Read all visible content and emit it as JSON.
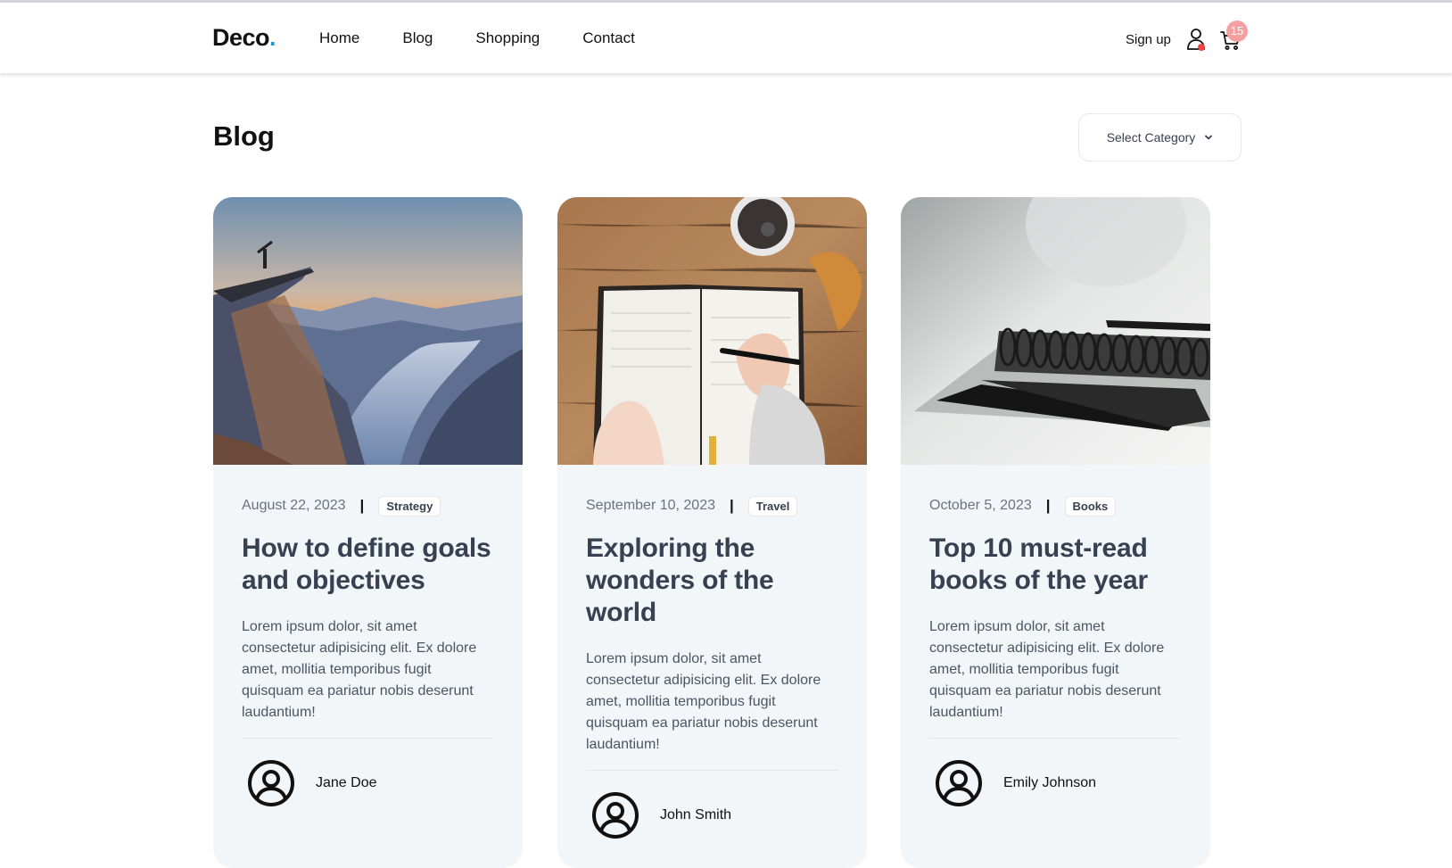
{
  "brand": {
    "name": "Deco",
    "dot": ".",
    "accent": "#1d9bd6"
  },
  "nav": [
    "Home",
    "Blog",
    "Shopping",
    "Contact"
  ],
  "header": {
    "signup": "Sign up",
    "cart_count": "15"
  },
  "page": {
    "title": "Blog",
    "select_label": "Select Category"
  },
  "cards": [
    {
      "image": "mountain-cliff-fjord-photo",
      "date": "August 22, 2023",
      "category": "Strategy",
      "title": "How to define goals and objectives",
      "excerpt": "Lorem ipsum dolor, sit amet consectetur adipisicing elit. Ex dolore amet, mollitia temporibus fugit quisquam ea pariatur nobis deserunt laudantium!",
      "author": "Jane Doe"
    },
    {
      "image": "notebook-writing-coffee-photo",
      "date": "September 10, 2023",
      "category": "Travel",
      "title": "Exploring the wonders of the world",
      "excerpt": "Lorem ipsum dolor, sit amet consectetur adipisicing elit. Ex dolore amet, mollitia temporibus fugit quisquam ea pariatur nobis deserunt laudantium!",
      "author": "John Smith"
    },
    {
      "image": "spiral-notebook-phone-photo",
      "date": "October 5, 2023",
      "category": "Books",
      "title": "Top 10 must-read books of the year",
      "excerpt": "Lorem ipsum dolor, sit amet consectetur adipisicing elit. Ex dolore amet, mollitia temporibus fugit quisquam ea pariatur nobis deserunt laudantium!",
      "author": "Emily Johnson"
    }
  ]
}
